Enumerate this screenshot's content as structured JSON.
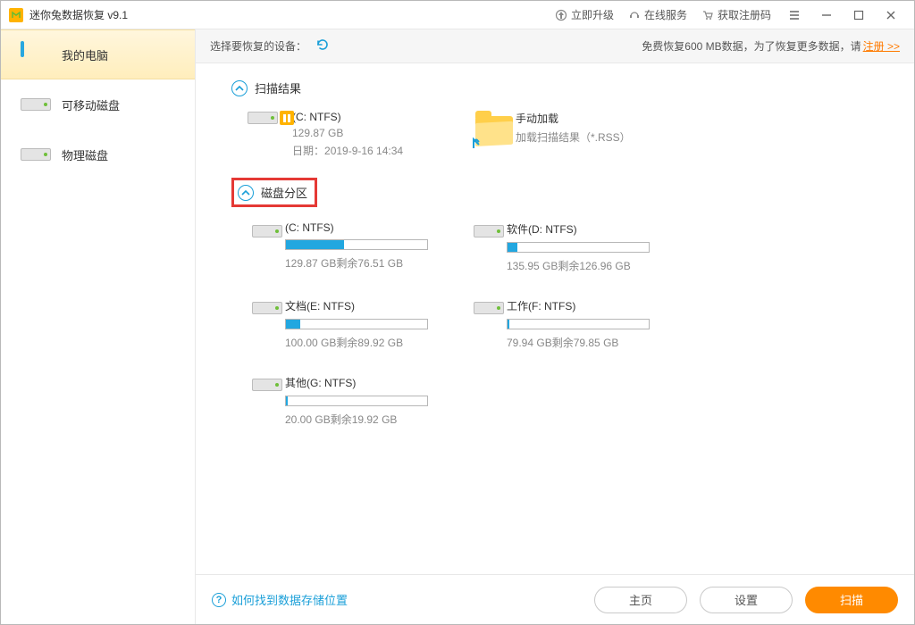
{
  "titlebar": {
    "title": "迷你兔数据恢复 v9.1",
    "upgrade": "立即升级",
    "online_service": "在线服务",
    "get_reg_code": "获取注册码"
  },
  "sidebar": {
    "items": [
      {
        "label": "我的电脑"
      },
      {
        "label": "可移动磁盘"
      },
      {
        "label": "物理磁盘"
      }
    ]
  },
  "infobar": {
    "select_device": "选择要恢复的设备：",
    "promo_prefix": "免费恢复600 MB数据，为了恢复更多数据，请",
    "register_link": "注册 >>"
  },
  "sections": {
    "scan_results": "扫描结果",
    "disk_partitions": "磁盘分区"
  },
  "scan_result_item": {
    "name": "(C: NTFS)",
    "size": "129.87 GB",
    "date_label": "日期：",
    "date": "2019-9-16 14:34"
  },
  "manual_load": {
    "title": "手动加载",
    "subtitle": "加载扫描结果（*.RSS）"
  },
  "partitions": [
    {
      "name": "(C: NTFS)",
      "info": "129.87 GB剩余76.51 GB",
      "used_pct": 41
    },
    {
      "name": "软件(D: NTFS)",
      "info": "135.95 GB剩余126.96 GB",
      "used_pct": 7
    },
    {
      "name": "文档(E: NTFS)",
      "info": "100.00 GB剩余89.92 GB",
      "used_pct": 10
    },
    {
      "name": "工作(F: NTFS)",
      "info": "79.94 GB剩余79.85 GB",
      "used_pct": 1
    },
    {
      "name": "其他(G: NTFS)",
      "info": "20.00 GB剩余19.92 GB",
      "used_pct": 1
    }
  ],
  "footer": {
    "help_link": "如何找到数据存储位置",
    "home": "主页",
    "settings": "设置",
    "scan": "扫描"
  }
}
